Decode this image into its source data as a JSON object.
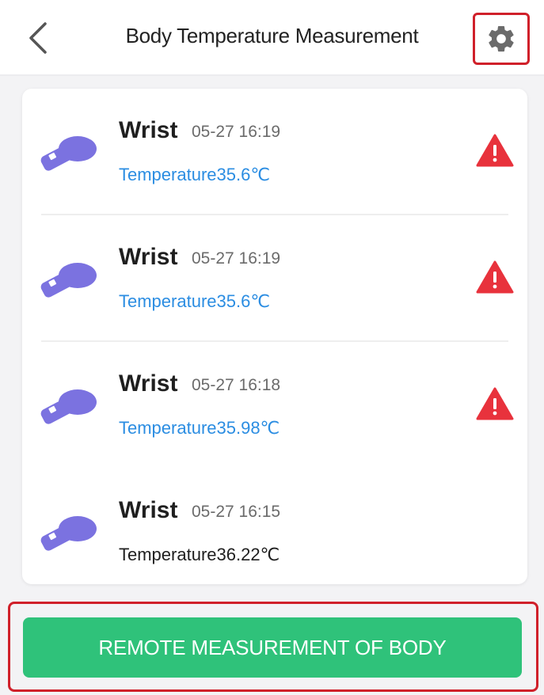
{
  "header": {
    "title": "Body Temperature Measurement",
    "back_icon": "chevron-left-icon",
    "settings_icon": "gear-icon"
  },
  "records": [
    {
      "location": "Wrist",
      "time": "05-27 16:19",
      "temperature": "Temperature35.6℃",
      "status": "alert"
    },
    {
      "location": "Wrist",
      "time": "05-27 16:19",
      "temperature": "Temperature35.6℃",
      "status": "alert"
    },
    {
      "location": "Wrist",
      "time": "05-27 16:18",
      "temperature": "Temperature35.98℃",
      "status": "alert"
    },
    {
      "location": "Wrist",
      "time": "05-27 16:15",
      "temperature": "Temperature36.22℃",
      "status": "normal"
    }
  ],
  "action": {
    "remote_label": "REMOTE MEASUREMENT OF BODY"
  },
  "colors": {
    "accent_green": "#2fc27a",
    "alert_red": "#e8323c",
    "temp_blue": "#2b8de2",
    "icon_purple": "#7b72e0"
  }
}
